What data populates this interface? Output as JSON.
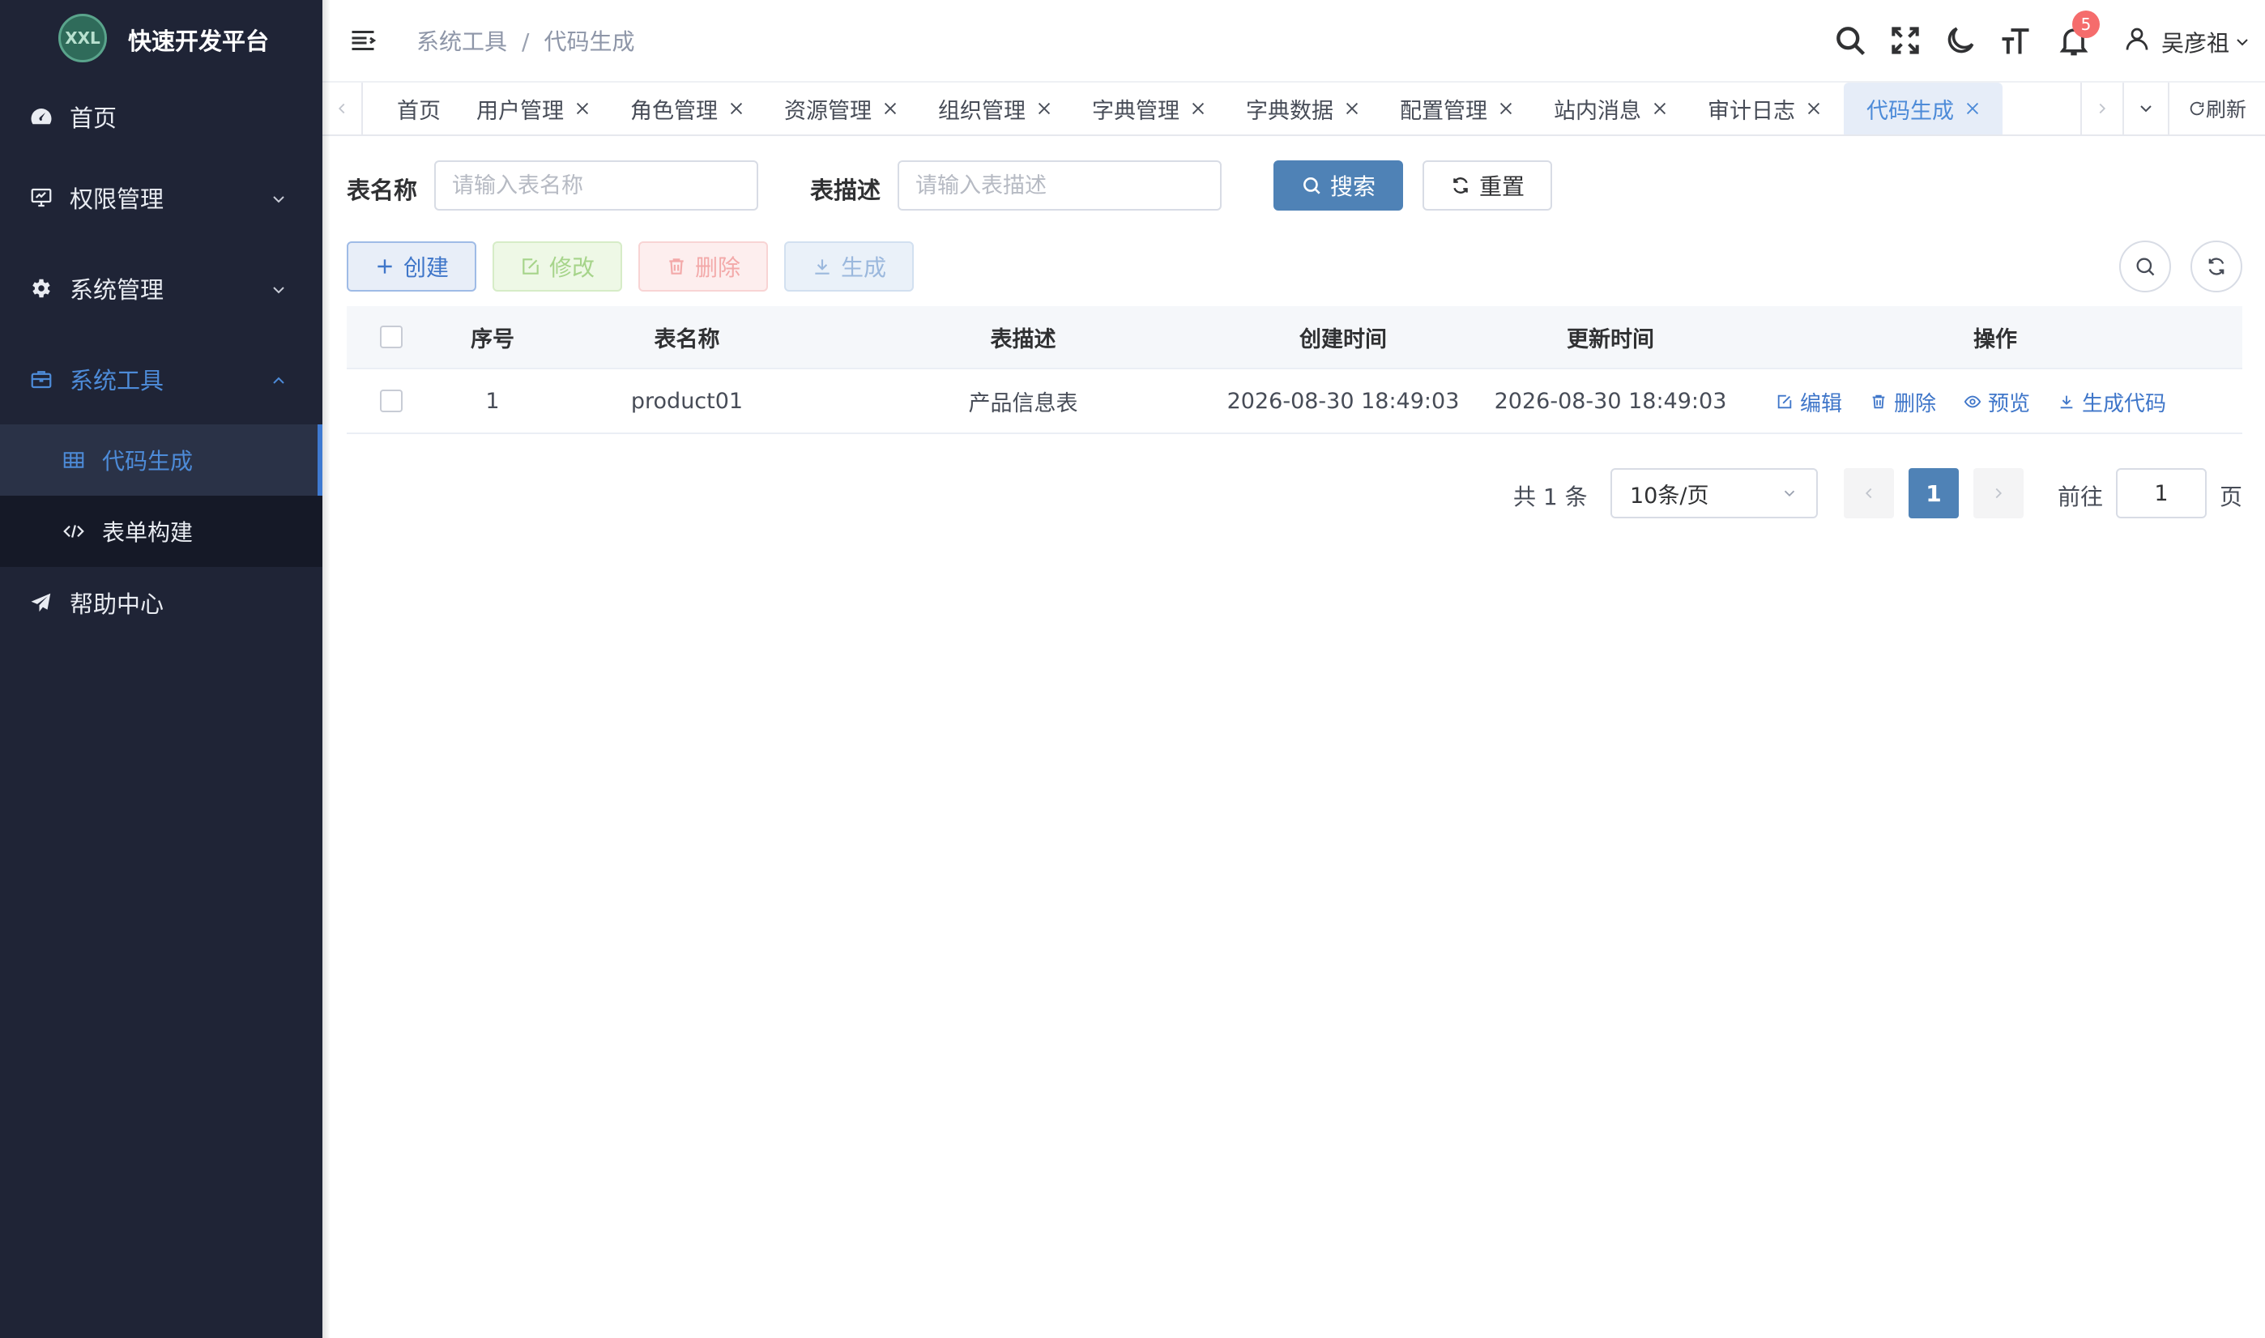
{
  "app": {
    "logo_text": "XXL",
    "title": "快速开发平台"
  },
  "sidebar": {
    "items": [
      {
        "label": "首页",
        "icon": "dashboard-icon"
      },
      {
        "label": "权限管理",
        "icon": "monitor-chart-icon"
      },
      {
        "label": "系统管理",
        "icon": "gear-icon"
      },
      {
        "label": "系统工具",
        "icon": "toolbox-icon"
      },
      {
        "label": "帮助中心",
        "icon": "paper-plane-icon"
      }
    ],
    "sub_items": [
      {
        "label": "代码生成",
        "icon": "grid-table-icon"
      },
      {
        "label": "表单构建",
        "icon": "code-brackets-icon"
      }
    ]
  },
  "header": {
    "breadcrumb": [
      "系统工具",
      "代码生成"
    ],
    "notification_count": "5",
    "user_name": "吴彦祖"
  },
  "tabs": {
    "items": [
      "首页",
      "用户管理",
      "角色管理",
      "资源管理",
      "组织管理",
      "字典管理",
      "字典数据",
      "配置管理",
      "站内消息",
      "审计日志",
      "代码生成"
    ],
    "active": "代码生成",
    "refresh_label": "刷新"
  },
  "search_form": {
    "table_name_label": "表名称",
    "table_name_placeholder": "请输入表名称",
    "table_desc_label": "表描述",
    "table_desc_placeholder": "请输入表描述",
    "search_label": "搜索",
    "reset_label": "重置"
  },
  "toolbar": {
    "create_label": "创建",
    "edit_label": "修改",
    "delete_label": "删除",
    "generate_label": "生成"
  },
  "table": {
    "columns": [
      "序号",
      "表名称",
      "表描述",
      "创建时间",
      "更新时间",
      "操作"
    ],
    "rows": [
      {
        "index": "1",
        "table_name": "product01",
        "table_desc": "产品信息表",
        "created_at": "2026-08-30 18:49:03",
        "updated_at": "2026-08-30 18:49:03",
        "actions": [
          "编辑",
          "删除",
          "预览",
          "生成代码"
        ]
      }
    ]
  },
  "pagination": {
    "total_text": "共 1 条",
    "page_size": "10条/页",
    "current_page": "1",
    "goto_label": "前往",
    "goto_value": "1",
    "page_suffix": "页"
  },
  "colors": {
    "sidebar_bg": "#1f2436",
    "accent": "#4d8bd8",
    "primary_button": "#4f82b6",
    "badge": "#f56c6c"
  }
}
